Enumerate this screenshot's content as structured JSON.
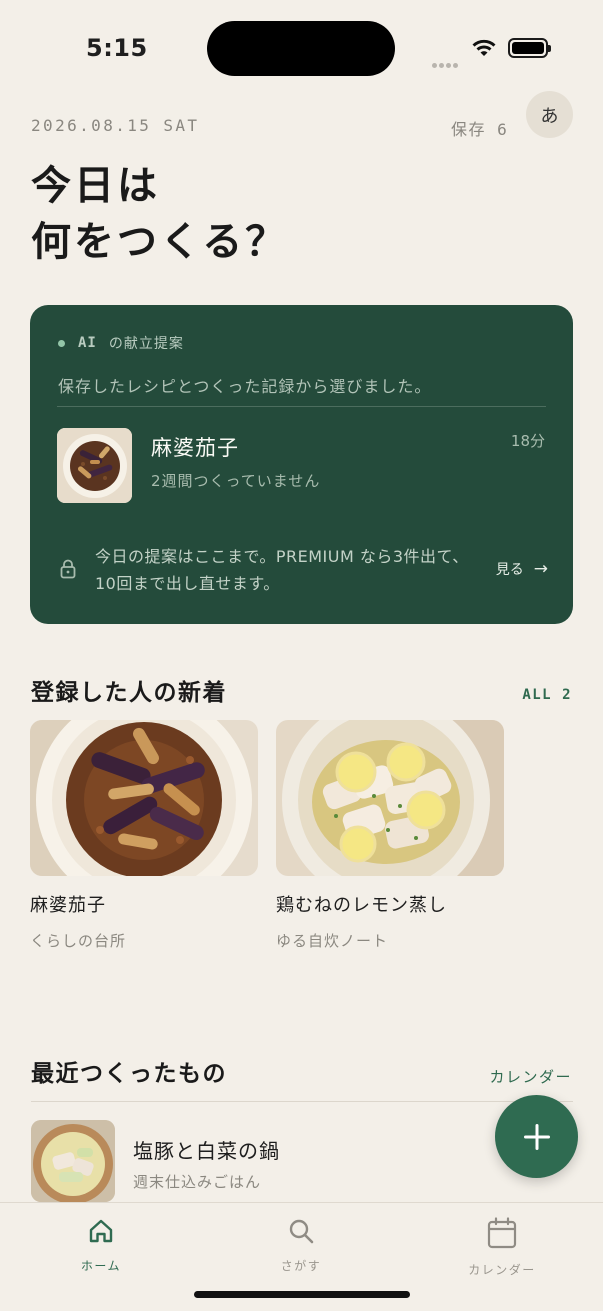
{
  "status_bar": {
    "time": "5:15"
  },
  "header": {
    "date": "2026.08.15 SAT",
    "saved_label": "保存",
    "saved_count": "6",
    "avatar_initial": "あ",
    "headline_line1": "今日は",
    "headline_line2": "何をつくる？"
  },
  "ai_card": {
    "tag_prefix": "AI",
    "tag_label": "の献立提案",
    "description": "保存したレシピとつくった記録から選びました。",
    "recipe_name": "麻婆茄子",
    "recipe_note": "2週間つくっていません",
    "duration": "18分",
    "premium_text": "今日の提案はここまで。PREMIUM なら3件出て、10回まで出し直せます。",
    "see_more_label": "見る"
  },
  "new_section": {
    "title": "登録した人の新着",
    "link_label": "ALL",
    "link_count": "2",
    "items": [
      {
        "title": "麻婆茄子",
        "author": "くらしの台所"
      },
      {
        "title": "鶏むねのレモン蒸し",
        "author": "ゆる自炊ノート"
      }
    ]
  },
  "recent_section": {
    "title": "最近つくったもの",
    "link_label": "カレンダー",
    "items": [
      {
        "title": "塩豚と白菜の鍋",
        "author": "週末仕込みごはん"
      }
    ]
  },
  "tab_bar": {
    "tabs": [
      {
        "label": "ホーム",
        "icon": "home-icon",
        "active": true
      },
      {
        "label": "さがす",
        "icon": "search-icon",
        "active": false
      },
      {
        "label": "カレンダー",
        "icon": "calendar-icon",
        "active": false
      }
    ]
  },
  "colors": {
    "background": "#f3efe8",
    "card": "#244b3b",
    "accent": "#2f6b51"
  }
}
